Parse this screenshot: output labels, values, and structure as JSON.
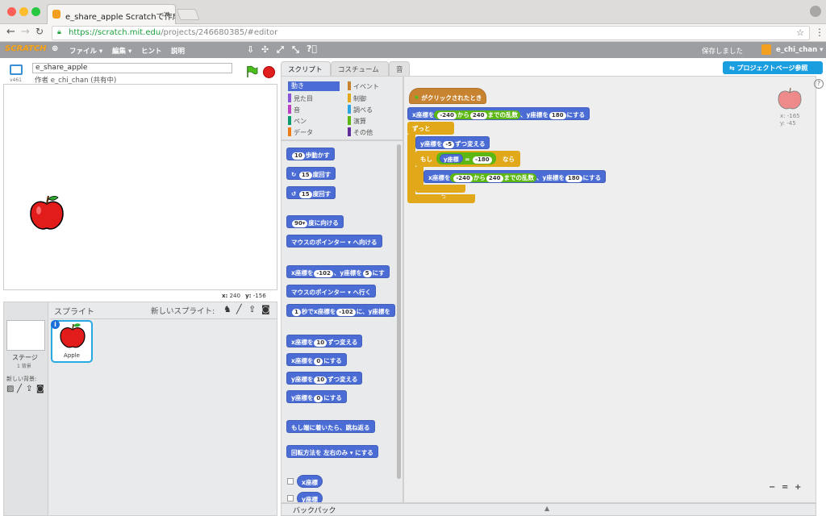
{
  "browser": {
    "tab_title": "e_share_apple Scratchで作成",
    "url_host": "https://scratch.mit.edu",
    "url_path": "/projects/246680385/#editor"
  },
  "menubar": {
    "logo": "SCRATCH",
    "items": [
      "ファイル ▾",
      "編集 ▾",
      "ヒント",
      "説明"
    ],
    "save_status": "保存しました",
    "user": "e_chi_chan ▾"
  },
  "stage": {
    "project_title": "e_share_apple",
    "author": "作者 e_chi_chan (共有中)",
    "version": "v461",
    "coord_x_label": "x:",
    "coord_x": "240",
    "coord_y_label": "y:",
    "coord_y": "-156"
  },
  "sprites_panel": {
    "title": "スプライト",
    "new_sprite_label": "新しいスプライト:",
    "stage_label": "ステージ",
    "stage_sub": "1 背景",
    "new_backdrop_label": "新しい背景:",
    "sprite_name": "Apple"
  },
  "editor_tabs": [
    "スクリプト",
    "コスチューム",
    "音"
  ],
  "categories": [
    {
      "label": "動き",
      "color": "#4a6cd4"
    },
    {
      "label": "イベント",
      "color": "#c88330"
    },
    {
      "label": "見た目",
      "color": "#8a55d7"
    },
    {
      "label": "制御",
      "color": "#e1a91a"
    },
    {
      "label": "音",
      "color": "#bb42c3"
    },
    {
      "label": "調べる",
      "color": "#2ca5e2"
    },
    {
      "label": "ペン",
      "color": "#0e9a6c"
    },
    {
      "label": "演算",
      "color": "#5cb712"
    },
    {
      "label": "データ",
      "color": "#ee7d16"
    },
    {
      "label": "その他",
      "color": "#632d99"
    }
  ],
  "palette": {
    "move_n": "10",
    "move": "歩動かす",
    "turn_r_n": "15",
    "turn_r": "度回す",
    "turn_l_n": "15",
    "turn_l": "度回す",
    "point_dir_n": "90▾",
    "point_dir": "度に向ける",
    "point_towards_target": "マウスのポインター ▾",
    "point_towards": "へ向ける",
    "goto_xy_1": "x座標を",
    "goto_xy_x": "-102",
    "goto_xy_2": "、y座標を",
    "goto_xy_y": "5",
    "goto_xy_3": "にす",
    "goto_target": "マウスのポインター ▾",
    "goto": "へ行く",
    "glide_n": "1",
    "glide_1": "秒でx座標を",
    "glide_x": "-102",
    "glide_2": "に、y座標を",
    "change_x_1": "x座標を",
    "change_x_n": "10",
    "change_x_2": "ずつ変える",
    "set_x_1": "x座標を",
    "set_x_n": "0",
    "set_x_2": "にする",
    "change_y_1": "y座標を",
    "change_y_n": "10",
    "change_y_2": "ずつ変える",
    "set_y_1": "y座標を",
    "set_y_n": "0",
    "set_y_2": "にする",
    "bounce": "もし端に着いたら、跳ね返る",
    "rotation_1": "回転方法を",
    "rotation_val": "左右のみ ▾",
    "rotation_2": "にする",
    "report_x": "x座標",
    "report_y": "y座標"
  },
  "script": {
    "hat": "がクリックされたとき",
    "goto_1": "x座標を",
    "goto_x1": "-240",
    "goto_2": "から",
    "goto_x2": "240",
    "goto_3": "までの乱数",
    "goto_4": "、y座標を",
    "goto_y": "180",
    "goto_5": "にする",
    "forever": "ずっと",
    "change_y_1": "y座標を",
    "change_y_n": "-5",
    "change_y_2": "ずつ変える",
    "if": "もし",
    "cond_left": "y座標",
    "cond_op": "=",
    "cond_right": "-180",
    "then": "なら",
    "inner_1": "x座標を",
    "inner_x1": "-240",
    "inner_2": "から",
    "inner_x2": "240",
    "inner_3": "までの乱数",
    "inner_4": "、y座標を",
    "inner_y": "180",
    "inner_5": "にする",
    "sprite_x": "x: -165",
    "sprite_y": "y: -45"
  },
  "project_page_button": "プロジェクトページ参照",
  "backpack_label": "バックパック",
  "zoom_labels": [
    "−",
    "=",
    "+"
  ]
}
